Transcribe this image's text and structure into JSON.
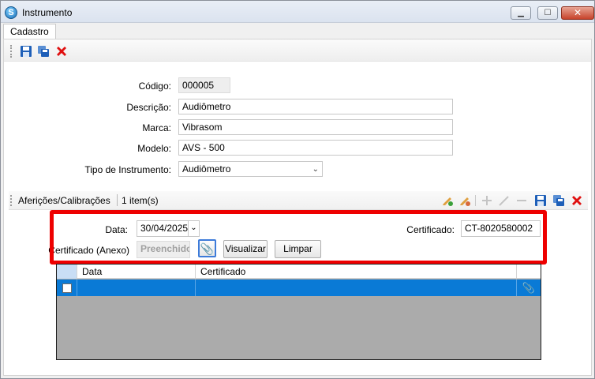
{
  "window": {
    "title": "Instrumento",
    "icon": "app-logo-icon",
    "controls": [
      "minimize-icon",
      "maximize-icon",
      "close-icon"
    ]
  },
  "tabs": [
    {
      "label": "Cadastro"
    }
  ],
  "toolbar": {
    "icons": [
      "save-icon",
      "save-copy-icon",
      "delete-icon"
    ]
  },
  "form": {
    "codigo": {
      "label": "Código:",
      "value": "000005"
    },
    "descricao": {
      "label": "Descrição:",
      "value": "Audiômetro"
    },
    "marca": {
      "label": "Marca:",
      "value": "Vibrasom"
    },
    "modelo": {
      "label": "Modelo:",
      "value": "AVS - 500"
    },
    "tipo": {
      "label": "Tipo de Instrumento:",
      "value": "Audiômetro"
    }
  },
  "section": {
    "title": "Aferições/Calibrações",
    "count": "1 item(s)",
    "icons": [
      "edit-add-icon",
      "edit-icon",
      "add-icon",
      "pencil-icon",
      "remove-icon",
      "save-icon",
      "save-copy-icon",
      "delete-icon"
    ]
  },
  "detail": {
    "data_label": "Data:",
    "data_value": "30/04/2025",
    "certificado_label": "Certificado:",
    "certificado_value": "CT-8020580002",
    "anexo_label": "Certificado (Anexo)",
    "anexo_placeholder": "Preenchido",
    "visualizar_label": "Visualizar",
    "limpar_label": "Limpar"
  },
  "grid": {
    "columns": [
      "Data",
      "Certificado"
    ],
    "rows": [
      {
        "data": "",
        "certificado": ""
      }
    ]
  },
  "colors": {
    "highlight_border": "#ee0000",
    "selected_row": "#0a7ad6",
    "grid_empty": "#ababab"
  }
}
